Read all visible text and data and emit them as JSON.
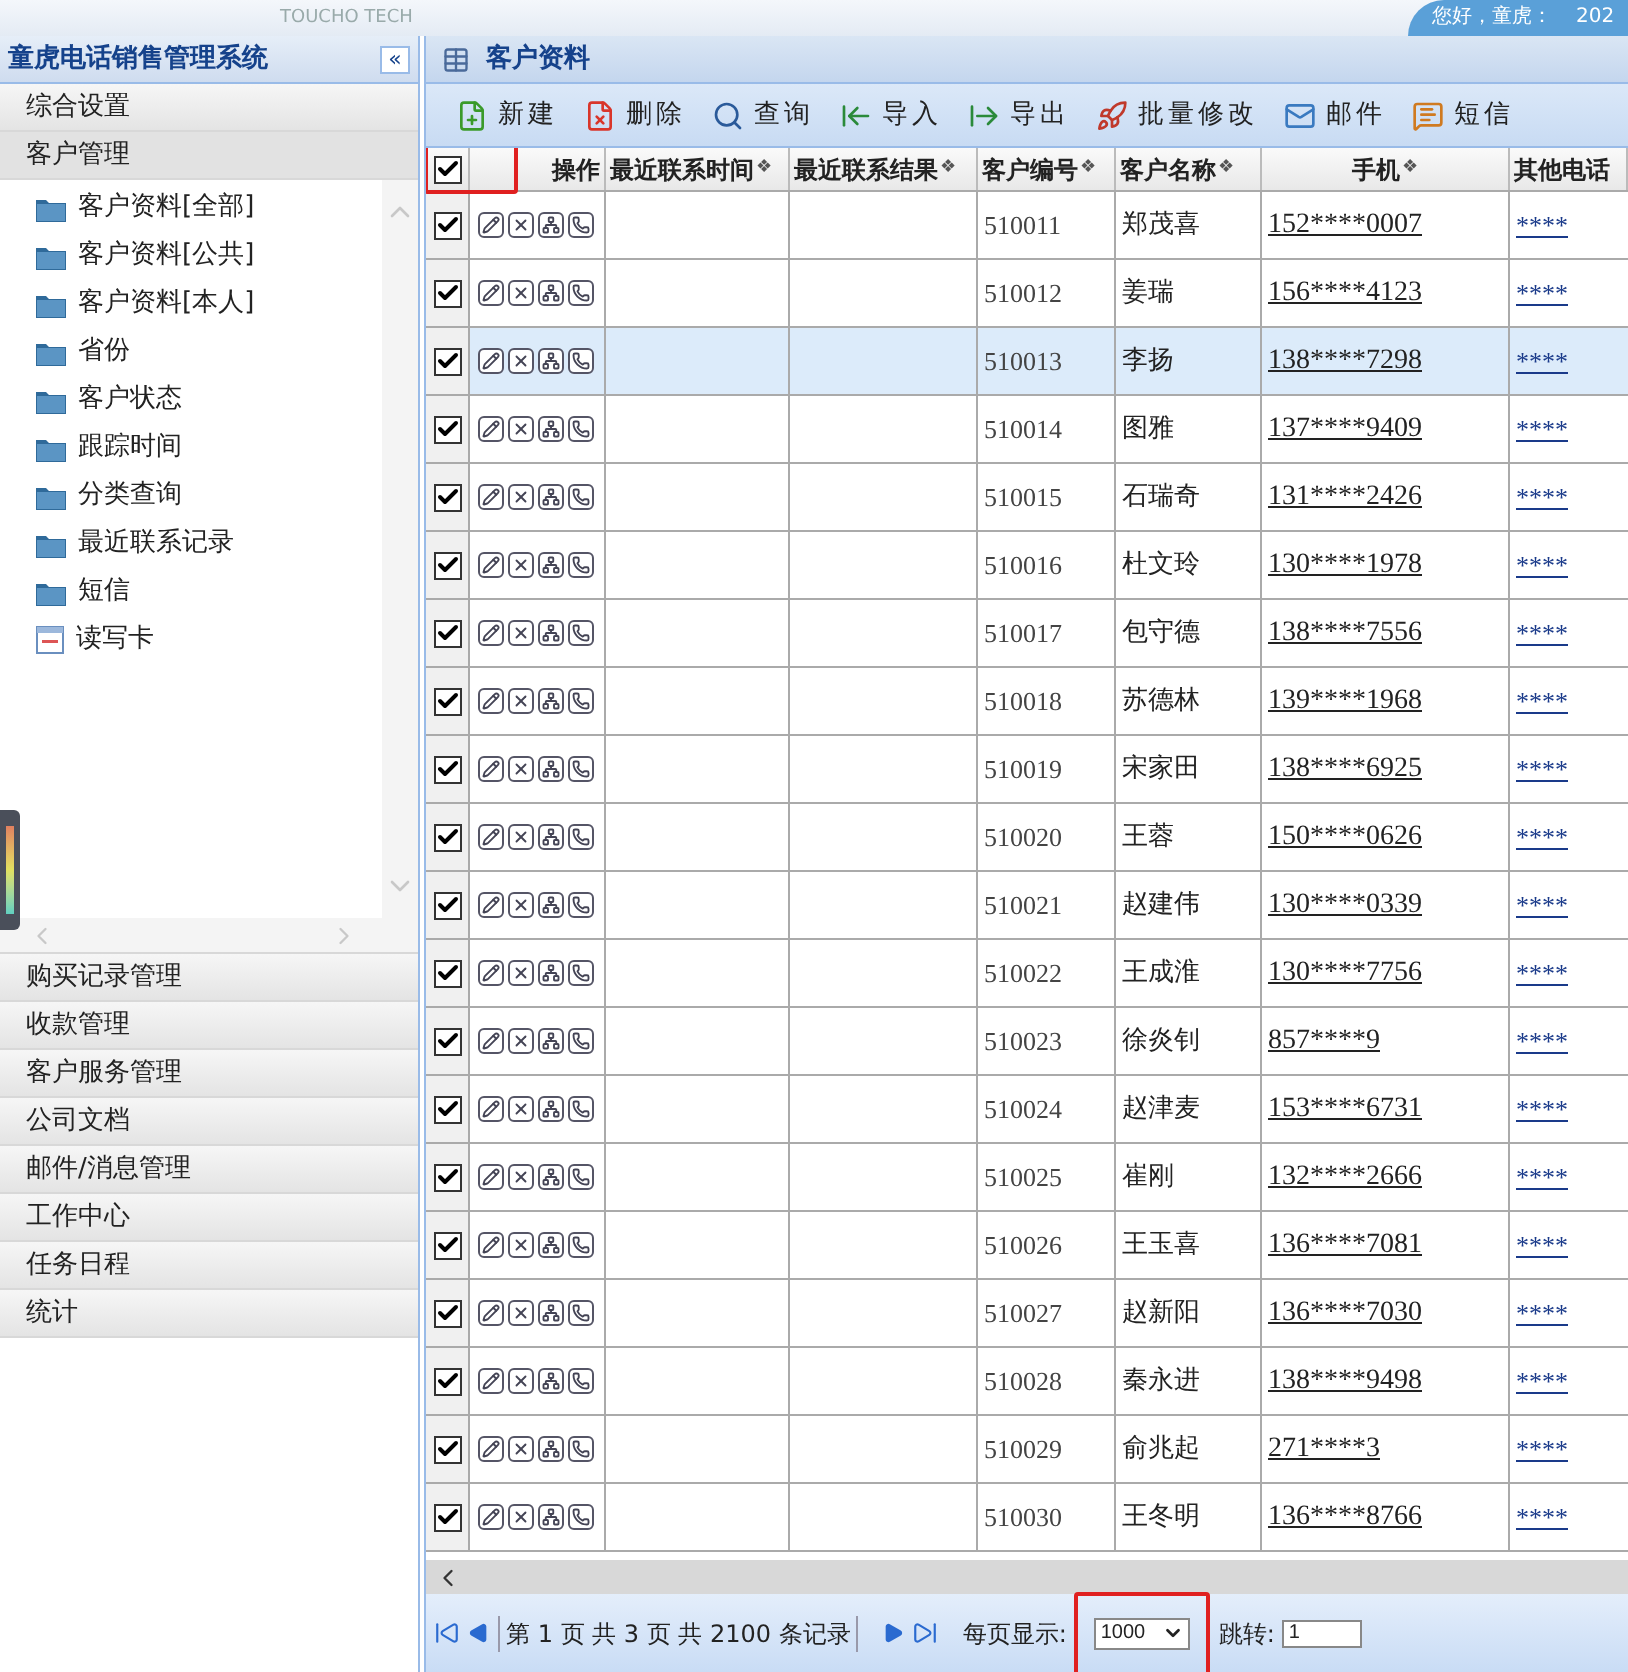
{
  "header": {
    "logo_text": "TOUCHO TECH",
    "greeting": "您好，童虎：",
    "date": "202"
  },
  "sidebar": {
    "title": "童虎电话销售管理系统",
    "collapse": "«",
    "sections": [
      {
        "label": "综合设置",
        "expanded": false
      },
      {
        "label": "客户管理",
        "expanded": true,
        "items": [
          {
            "label": "客户资料[全部]",
            "kind": "folder"
          },
          {
            "label": "客户资料[公共]",
            "kind": "folder"
          },
          {
            "label": "客户资料[本人]",
            "kind": "folder"
          },
          {
            "label": "省份",
            "kind": "folder"
          },
          {
            "label": "客户状态",
            "kind": "folder"
          },
          {
            "label": "跟踪时间",
            "kind": "folder"
          },
          {
            "label": "分类查询",
            "kind": "folder"
          },
          {
            "label": "最近联系记录",
            "kind": "folder"
          },
          {
            "label": "短信",
            "kind": "folder"
          },
          {
            "label": "读写卡",
            "kind": "card"
          }
        ]
      },
      {
        "label": "购买记录管理",
        "expanded": false
      },
      {
        "label": "收款管理",
        "expanded": false
      },
      {
        "label": "客户服务管理",
        "expanded": false
      },
      {
        "label": "公司文档",
        "expanded": false
      },
      {
        "label": "邮件/消息管理",
        "expanded": false
      },
      {
        "label": "工作中心",
        "expanded": false
      },
      {
        "label": "任务日程",
        "expanded": false
      },
      {
        "label": "统计",
        "expanded": false
      }
    ]
  },
  "panel": {
    "title": "客户资料",
    "toolbar": [
      {
        "label": "新建",
        "kind": "new"
      },
      {
        "label": "删除",
        "kind": "delete"
      },
      {
        "label": "查询",
        "kind": "search"
      },
      {
        "label": "导入",
        "kind": "import"
      },
      {
        "label": "导出",
        "kind": "export"
      },
      {
        "label": "批量修改",
        "kind": "batch"
      },
      {
        "label": "邮件",
        "kind": "mail"
      },
      {
        "label": "短信",
        "kind": "sms"
      }
    ],
    "table": {
      "select_all_checked": true,
      "highlight_select_all": true,
      "columns": [
        {
          "label": "操作"
        },
        {
          "label": "最近联系时间",
          "sort": "❖"
        },
        {
          "label": "最近联系结果",
          "sort": "❖"
        },
        {
          "label": "客户编号",
          "sort": "❖"
        },
        {
          "label": "客户名称",
          "sort": "❖"
        },
        {
          "label": "手机",
          "sort": "❖"
        },
        {
          "label": "其他电话"
        }
      ],
      "rows": [
        {
          "checked": true,
          "selected": false,
          "id": "510011",
          "name": "郑茂喜",
          "mobile": "152****0007",
          "other": "****"
        },
        {
          "checked": true,
          "selected": false,
          "id": "510012",
          "name": "姜瑞",
          "mobile": "156****4123",
          "other": "****"
        },
        {
          "checked": true,
          "selected": true,
          "id": "510013",
          "name": "李扬",
          "mobile": "138****7298",
          "other": "****"
        },
        {
          "checked": true,
          "selected": false,
          "id": "510014",
          "name": "图雅",
          "mobile": "137****9409",
          "other": "****"
        },
        {
          "checked": true,
          "selected": false,
          "id": "510015",
          "name": "石瑞奇",
          "mobile": "131****2426",
          "other": "****"
        },
        {
          "checked": true,
          "selected": false,
          "id": "510016",
          "name": "杜文玲",
          "mobile": "130****1978",
          "other": "****"
        },
        {
          "checked": true,
          "selected": false,
          "id": "510017",
          "name": "包守德",
          "mobile": "138****7556",
          "other": "****"
        },
        {
          "checked": true,
          "selected": false,
          "id": "510018",
          "name": "苏德林",
          "mobile": "139****1968",
          "other": "****"
        },
        {
          "checked": true,
          "selected": false,
          "id": "510019",
          "name": "宋家田",
          "mobile": "138****6925",
          "other": "****"
        },
        {
          "checked": true,
          "selected": false,
          "id": "510020",
          "name": "王蓉",
          "mobile": "150****0626",
          "other": "****"
        },
        {
          "checked": true,
          "selected": false,
          "id": "510021",
          "name": "赵建伟",
          "mobile": "130****0339",
          "other": "****"
        },
        {
          "checked": true,
          "selected": false,
          "id": "510022",
          "name": "王成淮",
          "mobile": "130****7756",
          "other": "****"
        },
        {
          "checked": true,
          "selected": false,
          "id": "510023",
          "name": "徐炎钊",
          "mobile": "857****9",
          "other": "****"
        },
        {
          "checked": true,
          "selected": false,
          "id": "510024",
          "name": "赵津麦",
          "mobile": "153****6731",
          "other": "****"
        },
        {
          "checked": true,
          "selected": false,
          "id": "510025",
          "name": "崔刚",
          "mobile": "132****2666",
          "other": "****"
        },
        {
          "checked": true,
          "selected": false,
          "id": "510026",
          "name": "王玉喜",
          "mobile": "136****7081",
          "other": "****"
        },
        {
          "checked": true,
          "selected": false,
          "id": "510027",
          "name": "赵新阳",
          "mobile": "136****7030",
          "other": "****"
        },
        {
          "checked": true,
          "selected": false,
          "id": "510028",
          "name": "秦永进",
          "mobile": "138****9498",
          "other": "****"
        },
        {
          "checked": true,
          "selected": false,
          "id": "510029",
          "name": "俞兆起",
          "mobile": "271****3",
          "other": "****"
        },
        {
          "checked": true,
          "selected": false,
          "id": "510030",
          "name": "王冬明",
          "mobile": "136****8766",
          "other": "****"
        }
      ]
    },
    "pager": {
      "info": "第 1 页 共 3 页 共 2100 条记录",
      "page_size_label": "每页显示:",
      "page_size": "1000",
      "highlight_page_size": true,
      "jump_label": "跳转:",
      "jump_value": "1"
    }
  }
}
